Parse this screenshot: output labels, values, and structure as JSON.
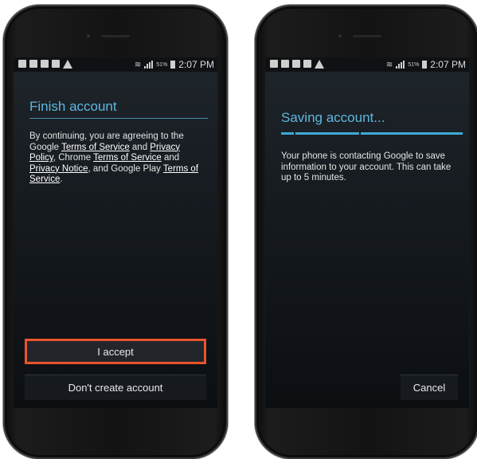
{
  "status_bar": {
    "time": "2:07 PM",
    "battery": "51%",
    "icons": [
      "screenshot-icon",
      "image-icon",
      "video-icon",
      "email-icon",
      "warning-icon",
      "wifi-icon",
      "signal-icon",
      "battery-icon"
    ]
  },
  "left_screen": {
    "title": "Finish account",
    "body": {
      "t1": "By continuing, you are agreeing to the Google ",
      "l1": "Terms of Service",
      "t2": " and ",
      "l2": "Privacy Policy",
      "t3": ", Chrome ",
      "l3": "Terms of Service",
      "t4": " and ",
      "l4": "Privacy Notice",
      "t5": ", and Google Play ",
      "l5": "Terms of Service",
      "t6": "."
    },
    "accept_label": "I accept",
    "decline_label": "Don't create account"
  },
  "right_screen": {
    "title": "Saving account...",
    "body": "Your phone is contacting Google to save information to your account. This can take up to 5 minutes.",
    "cancel_label": "Cancel"
  },
  "colors": {
    "accent_blue": "#5fb7de",
    "highlight_orange": "#e8542c",
    "progress": "#3fa9d6"
  }
}
